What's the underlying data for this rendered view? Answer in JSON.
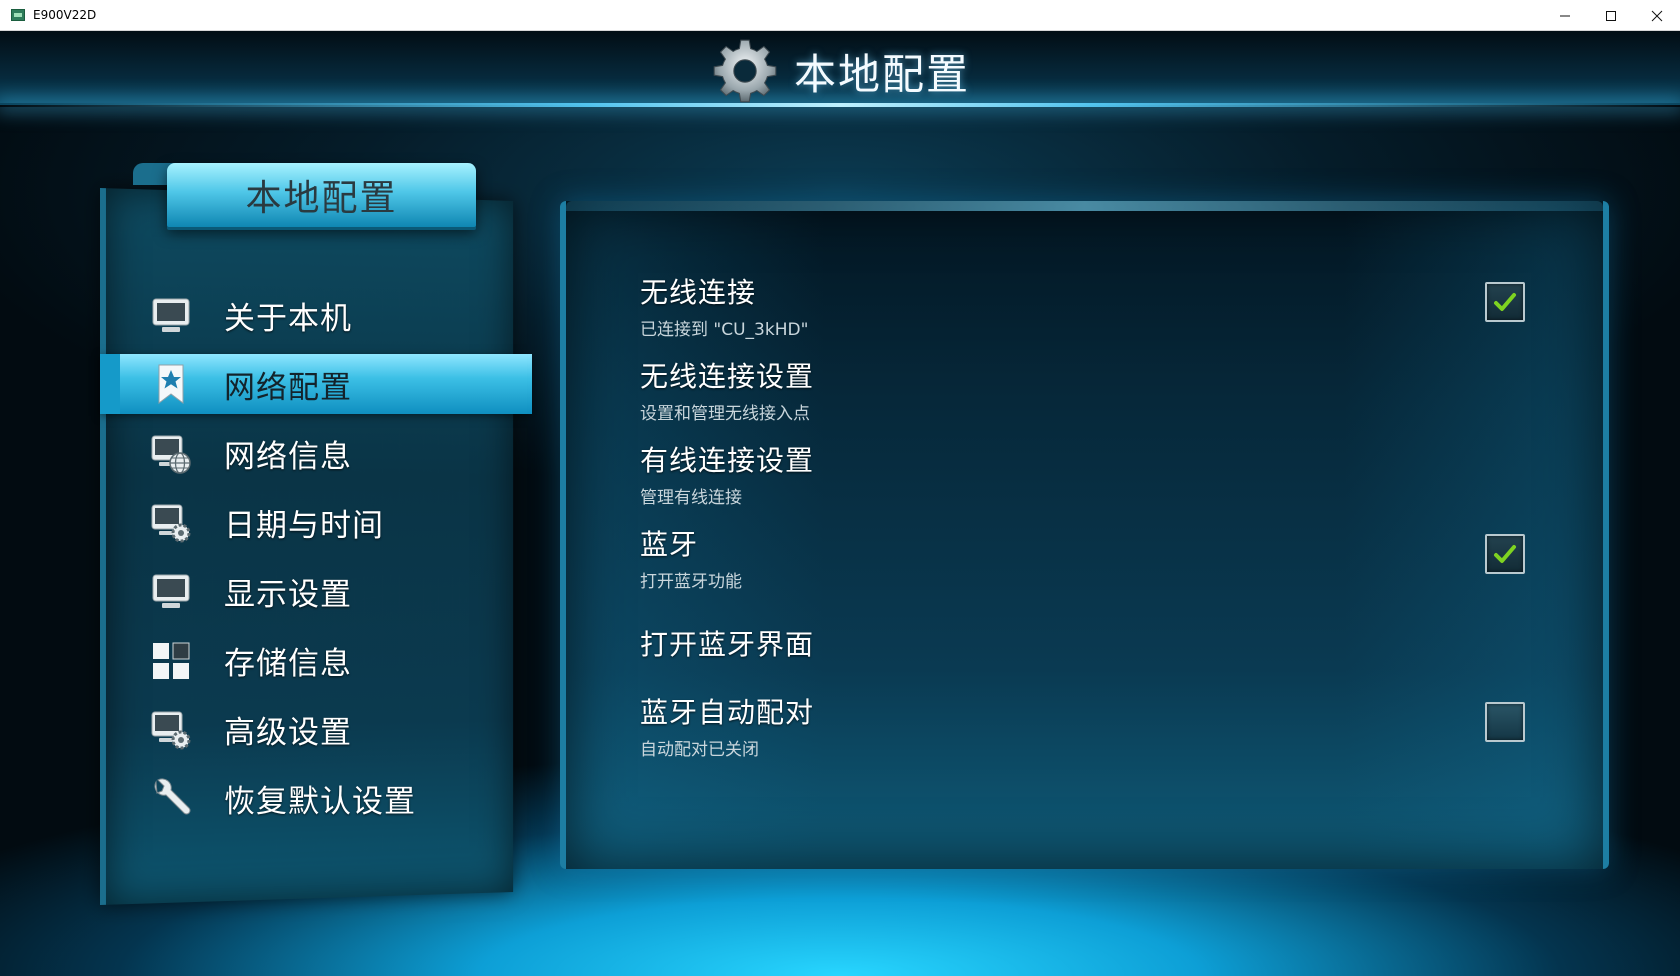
{
  "window": {
    "title": "E900V22D",
    "controls": {
      "minimize": "—",
      "maximize": "☐",
      "close": "✕"
    }
  },
  "header": {
    "icon": "gear-icon",
    "title": "本地配置"
  },
  "sidebar": {
    "tab_label": "本地配置",
    "selected_index": 1,
    "items": [
      {
        "label": "关于本机",
        "icon": "monitor-icon"
      },
      {
        "label": "网络配置",
        "icon": "bookmark-star-icon"
      },
      {
        "label": "网络信息",
        "icon": "monitor-globe-icon"
      },
      {
        "label": "日期与时间",
        "icon": "monitor-gear-icon"
      },
      {
        "label": "显示设置",
        "icon": "monitor-icon"
      },
      {
        "label": "存储信息",
        "icon": "grid-icon"
      },
      {
        "label": "高级设置",
        "icon": "monitor-gear-icon"
      },
      {
        "label": "恢复默认设置",
        "icon": "wrench-icon"
      }
    ]
  },
  "settings": {
    "items": [
      {
        "title": "无线连接",
        "subtitle": "已连接到 \"CU_3kHD\"",
        "checkbox": true,
        "checked": true
      },
      {
        "title": "无线连接设置",
        "subtitle": "设置和管理无线接入点",
        "checkbox": false
      },
      {
        "title": "有线连接设置",
        "subtitle": "管理有线连接",
        "checkbox": false
      },
      {
        "title": "蓝牙",
        "subtitle": "打开蓝牙功能",
        "checkbox": true,
        "checked": true
      },
      {
        "title": "打开蓝牙界面",
        "subtitle": "",
        "checkbox": false
      },
      {
        "title": "蓝牙自动配对",
        "subtitle": "自动配对已关闭",
        "checkbox": true,
        "checked": false
      }
    ]
  },
  "colors": {
    "accent": "#3cc0e6",
    "check_green": "#7ed321",
    "panel_dark": "#06283a"
  }
}
